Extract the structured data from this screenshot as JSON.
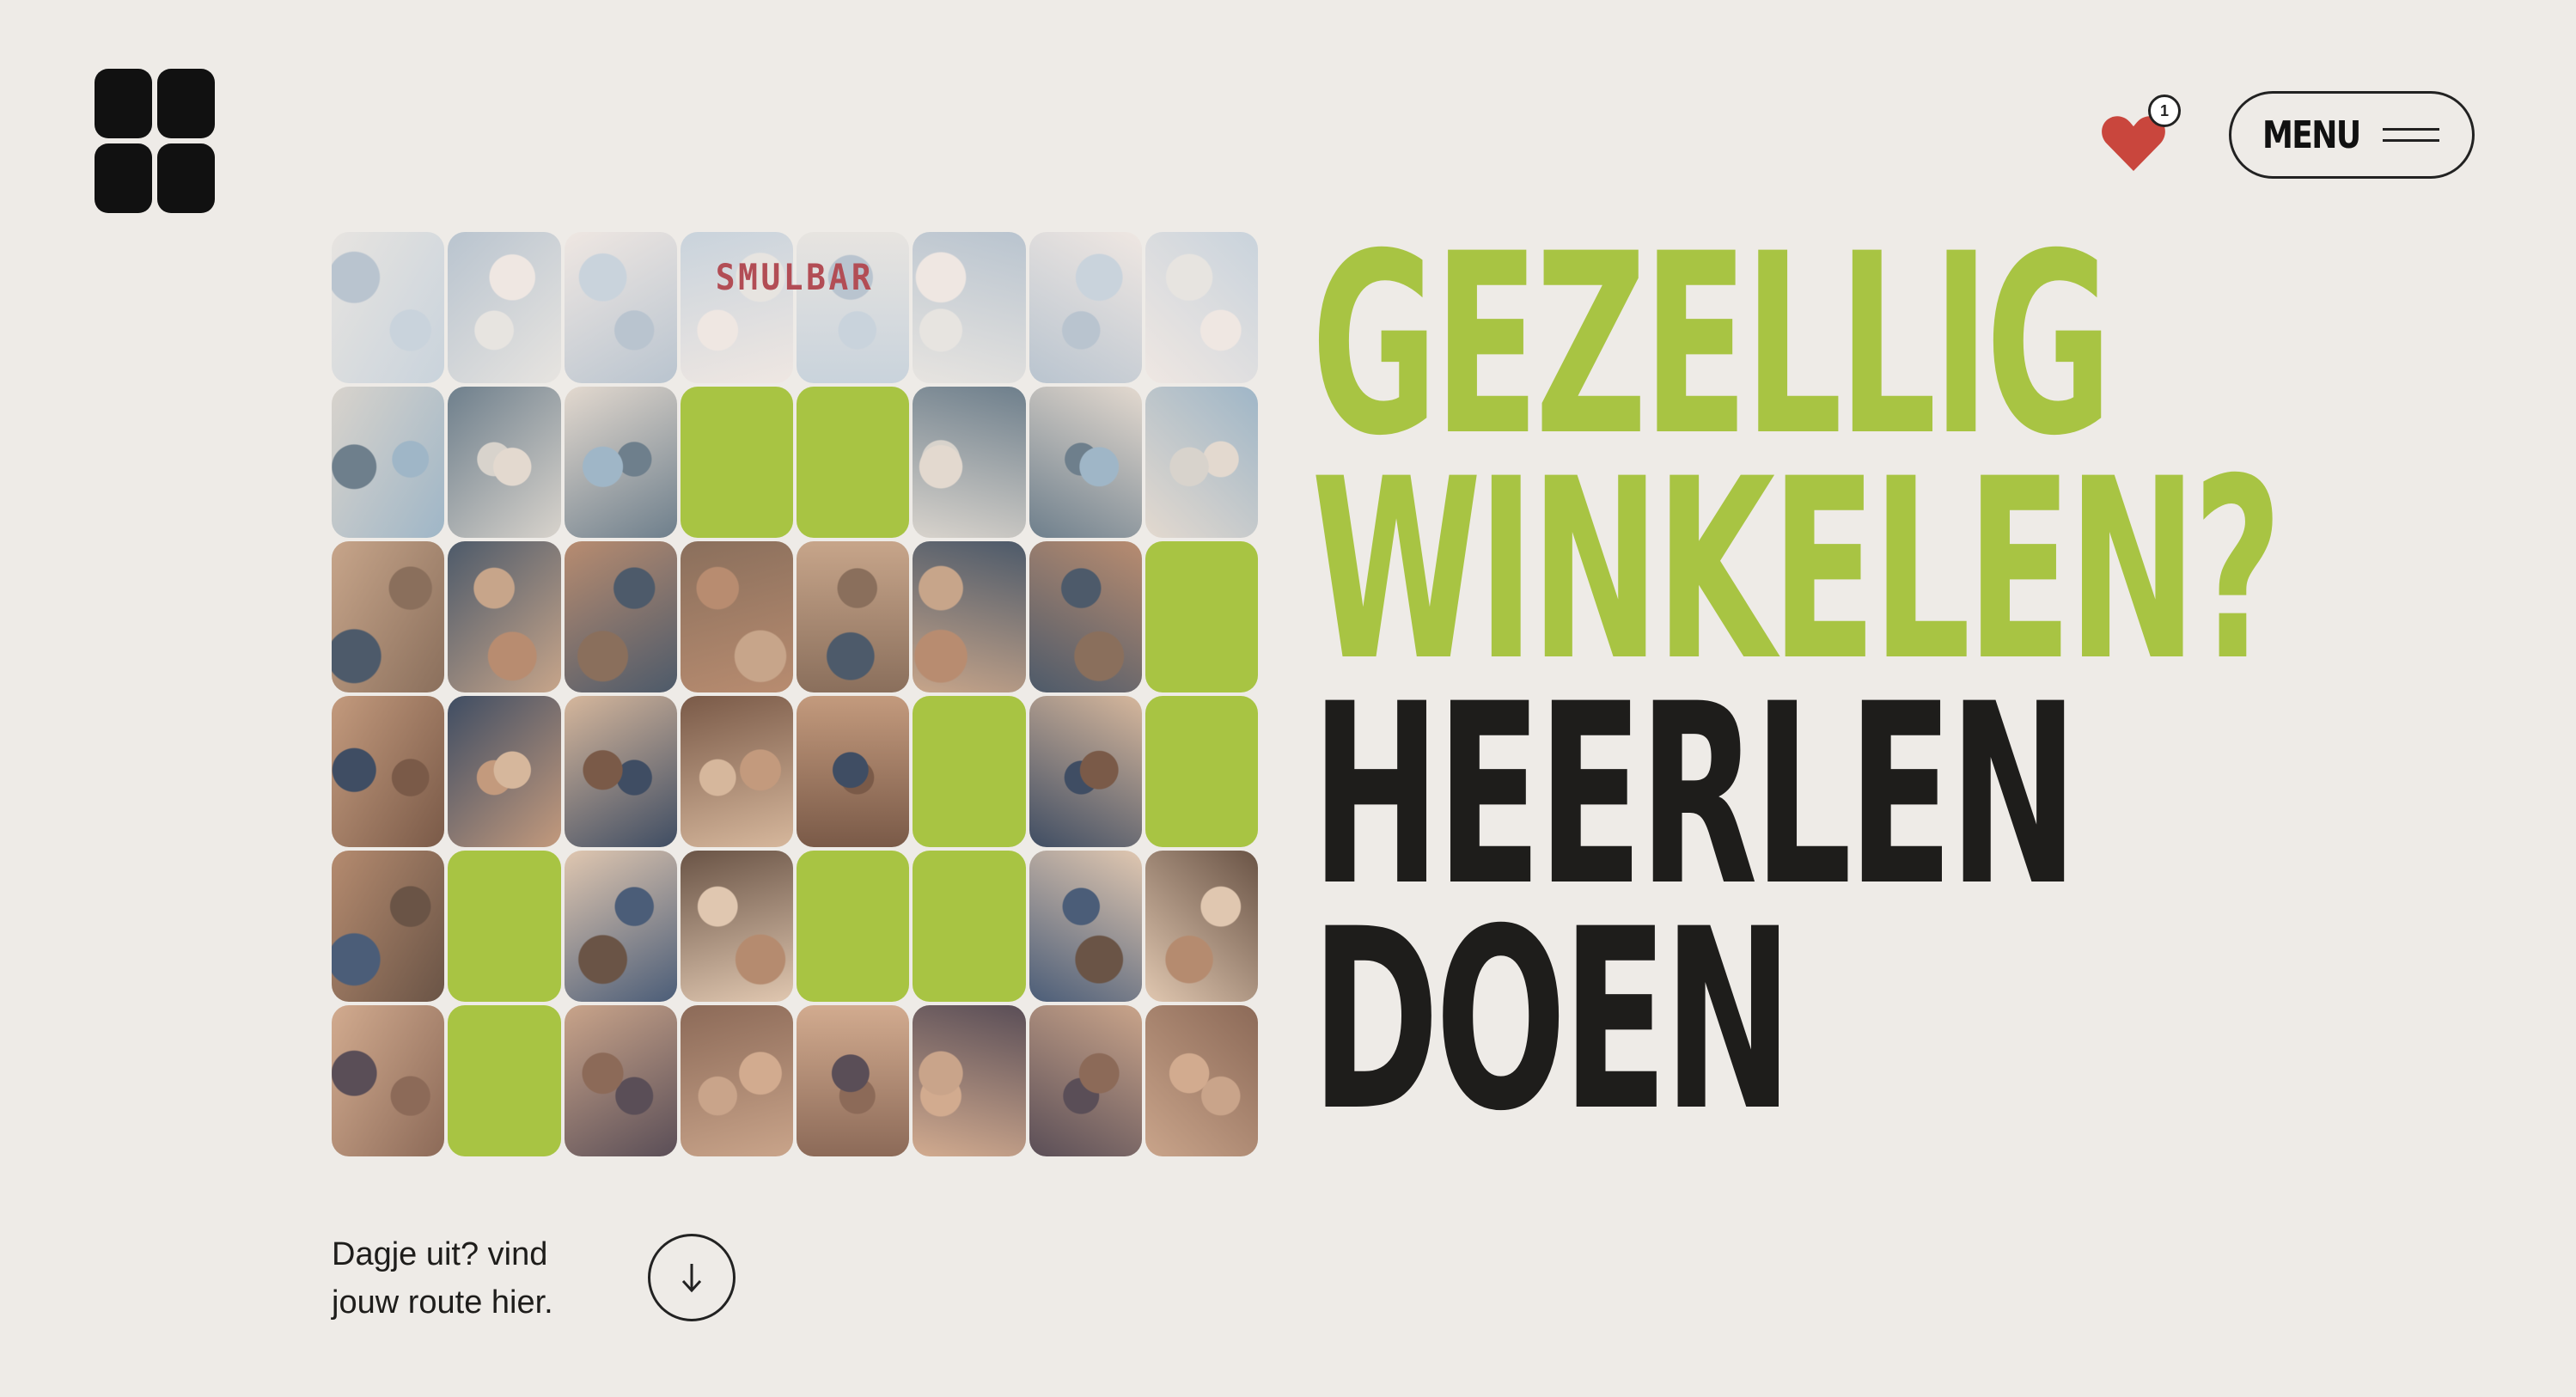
{
  "header": {
    "logo_icon": "four-squares-logo-icon",
    "favorites": {
      "icon": "heart-icon",
      "count": "1",
      "color": "#c9463d"
    },
    "menu": {
      "label": "MENU",
      "icon": "hamburger-icon"
    }
  },
  "hero": {
    "image": {
      "description_icon": "market-crowd-photo",
      "sign_text": "SMULBAR",
      "accent_color": "#a8c443",
      "green_tiles": [
        [
          1,
          3
        ],
        [
          1,
          4
        ],
        [
          2,
          7
        ],
        [
          3,
          5
        ],
        [
          3,
          7
        ],
        [
          4,
          1
        ],
        [
          4,
          4
        ],
        [
          4,
          5
        ],
        [
          5,
          1
        ]
      ]
    },
    "headline": {
      "line1": "GEZELLIG",
      "line2": "WINKELEN?",
      "line3": "HEERLEN",
      "line4": "DOEN"
    },
    "cta": {
      "line1": "Dagje uit? vind",
      "line2": "jouw route hier.",
      "scroll_icon": "arrow-down-icon"
    }
  },
  "colors": {
    "background": "#eeebe7",
    "green": "#a8c443",
    "dark": "#1e1d1b"
  }
}
